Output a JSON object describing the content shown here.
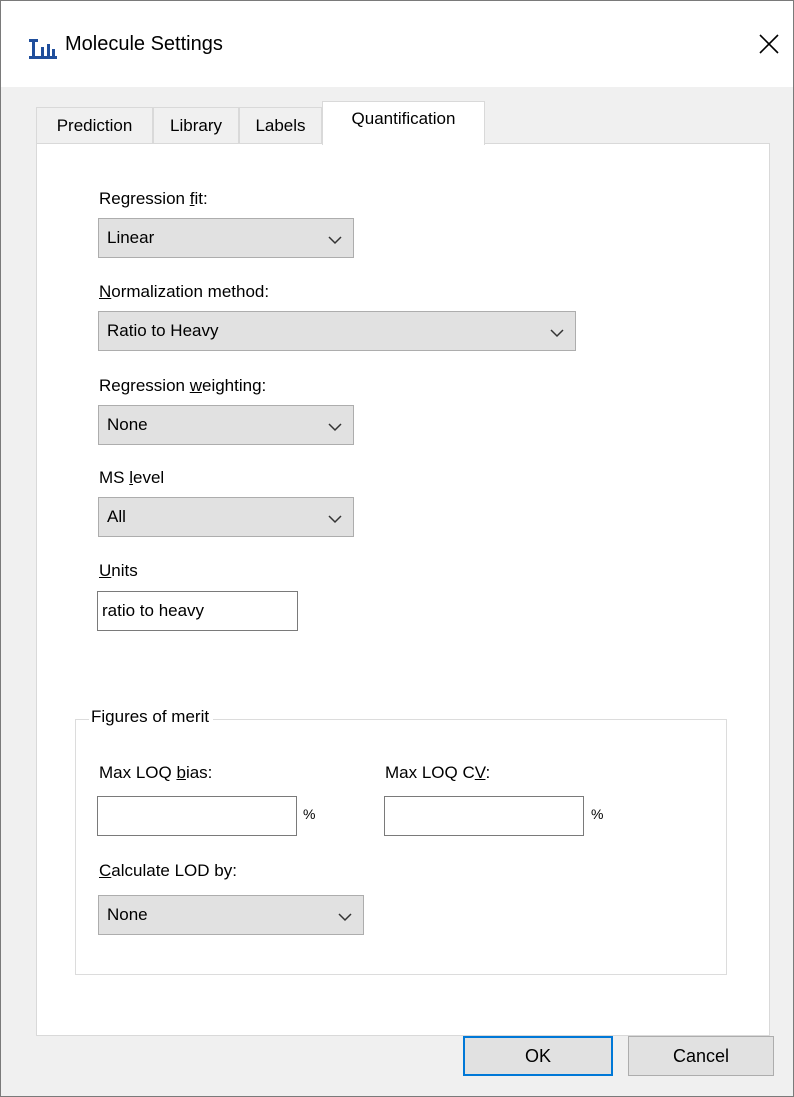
{
  "window": {
    "title": "Molecule Settings",
    "icon": "molecule-bar-icon",
    "close_icon": "close-icon"
  },
  "tabs": [
    {
      "label": "Prediction",
      "active": false
    },
    {
      "label": "Library",
      "active": false
    },
    {
      "label": "Labels",
      "active": false
    },
    {
      "label": "Quantification",
      "active": true
    }
  ],
  "quantification": {
    "regression_fit": {
      "label_pre": "Regression ",
      "label_mn": "f",
      "label_post": "it:",
      "value": "Linear"
    },
    "normalization_method": {
      "label_pre": "",
      "label_mn": "N",
      "label_post": "ormalization method:",
      "value": "Ratio to Heavy"
    },
    "regression_weighting": {
      "label_pre": "Regression ",
      "label_mn": "w",
      "label_post": "eighting:",
      "value": "None"
    },
    "ms_level": {
      "label_pre": "MS ",
      "label_mn": "l",
      "label_post": "evel",
      "value": "All"
    },
    "units": {
      "label_pre": "",
      "label_mn": "U",
      "label_post": "nits",
      "value": "ratio to heavy"
    }
  },
  "figures_of_merit": {
    "title": "Figures of merit",
    "max_loq_bias": {
      "label_pre": "Max LOQ ",
      "label_mn": "b",
      "label_post": "ias:",
      "value": "",
      "unit": "%"
    },
    "max_loq_cv": {
      "label_pre": "Max LOQ C",
      "label_mn": "V",
      "label_post": ":",
      "value": "",
      "unit": "%"
    },
    "calculate_lod_by": {
      "label_pre": "",
      "label_mn": "C",
      "label_post": "alculate LOD by:",
      "value": "None"
    }
  },
  "buttons": {
    "ok": "OK",
    "cancel": "Cancel"
  },
  "colors": {
    "dialog_bg": "#f0f0f0",
    "title_bg": "#ffffff",
    "combo_bg": "#e1e1e1",
    "default_button_border": "#0078d7",
    "icon_blue": "#1f4e9c"
  }
}
